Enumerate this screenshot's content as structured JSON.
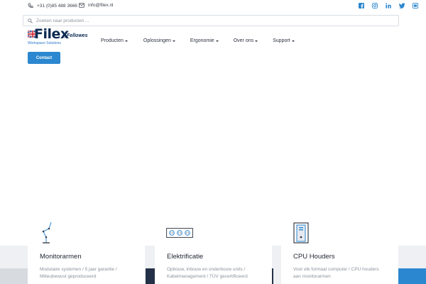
{
  "topbar": {
    "phone": "+31 (0)85 488 3666",
    "email": "info@filex.nl",
    "socials": [
      "facebook-icon",
      "instagram-icon",
      "linkedin-icon",
      "twitter-icon",
      "youtube-icon"
    ]
  },
  "search": {
    "placeholder": "Zoeken naar producten ..."
  },
  "logo": {
    "word": "Filex",
    "by": "by",
    "brand": "Fellowes",
    "tagline": "Workspace Solutions"
  },
  "nav": {
    "items": [
      {
        "label": "Producten"
      },
      {
        "label": "Oplossingen"
      },
      {
        "label": "Ergonomie"
      },
      {
        "label": "Over ons"
      },
      {
        "label": "Support"
      }
    ],
    "contact_label": "Contact"
  },
  "features": [
    {
      "title": "Monitorarmen",
      "text": "Modulaire systemen / 5 jaar garantie / Milieubewust geproduceerd",
      "icon": "monitor-arm-icon"
    },
    {
      "title": "Elektrificatie",
      "text": "Opbouw, inbouw en onderbouw units / Kabelmanagement / TÜV gecertificeerd",
      "icon": "power-strip-icon"
    },
    {
      "title": "CPU Houders",
      "text": "Voor elk formaat computer / CPU houders aan monitorarmen",
      "icon": "cpu-tower-icon"
    }
  ],
  "colors": {
    "accent": "#2b87cf",
    "navy": "#0c2a52",
    "dark": "#243047",
    "band": "#eef0f3"
  }
}
